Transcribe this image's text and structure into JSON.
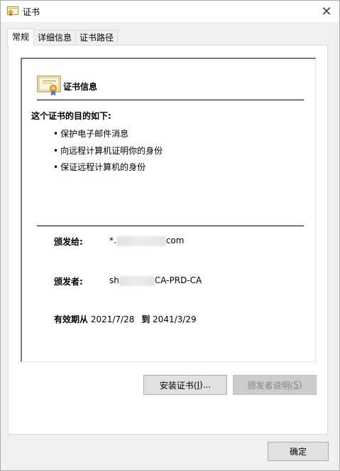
{
  "window": {
    "title": "证书",
    "close_glyph": "✕"
  },
  "tabs": [
    {
      "label": "常规",
      "active": true
    },
    {
      "label": "详细信息",
      "active": false
    },
    {
      "label": "证书路径",
      "active": false
    }
  ],
  "info": {
    "heading": "证书信息",
    "purpose_title": "这个证书的目的如下:",
    "purposes": [
      "保护电子邮件消息",
      "向远程计算机证明你的身份",
      "保证远程计算机的身份"
    ],
    "issued_to_label": "颁发给:",
    "issued_to_prefix": "*.",
    "issued_to_suffix": "com",
    "issued_by_label": "颁发者:",
    "issued_by_prefix": "sh",
    "issued_by_suffix": "CA-PRD-CA",
    "valid_from_label": "有效期从",
    "valid_from": "2021/7/28",
    "valid_to_label": "到",
    "valid_to": "2041/3/29"
  },
  "buttons": {
    "install_prefix": "安装证书(",
    "install_key": "I",
    "install_suffix": ")...",
    "issuer_stmt_prefix": "颁发者说明(",
    "issuer_stmt_key": "S",
    "issuer_stmt_suffix": ")",
    "ok": "确定"
  },
  "icons": {
    "title": "certificate-icon",
    "cert": "certificate-ribbon-icon",
    "close": "close-icon"
  }
}
